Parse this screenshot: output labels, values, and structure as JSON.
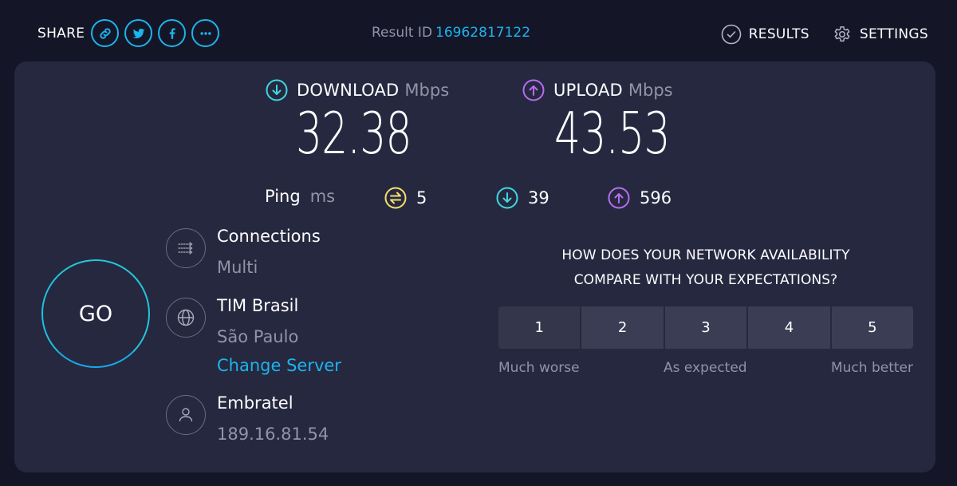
{
  "header": {
    "share_label": "SHARE",
    "share_buttons": [
      {
        "icon": "link-icon",
        "label": "Share link"
      },
      {
        "icon": "twitter-icon",
        "label": "Twitter"
      },
      {
        "icon": "facebook-icon",
        "label": "Facebook"
      },
      {
        "icon": "more-icon",
        "label": "More"
      }
    ],
    "result_id_label": "Result ID",
    "result_id_value": "16962817122",
    "nav": [
      {
        "icon": "checkmark-circle-icon",
        "label": "RESULTS"
      },
      {
        "icon": "gear-icon",
        "label": "SETTINGS"
      }
    ]
  },
  "colors": {
    "accent": "#1cb4ec",
    "download": "#3fd8e0",
    "upload": "#b56ef0",
    "ping": "#f5e06c",
    "background": "#141628",
    "card": "#262840"
  },
  "download": {
    "label": "DOWNLOAD",
    "unit": "Mbps",
    "value": "32.38"
  },
  "upload": {
    "label": "UPLOAD",
    "unit": "Mbps",
    "value": "43.53"
  },
  "ping": {
    "label": "Ping",
    "unit": "ms",
    "idle": "5",
    "download": "39",
    "upload": "596"
  },
  "go_label": "GO",
  "info": {
    "connections": {
      "title": "Connections",
      "value": "Multi"
    },
    "server": {
      "title": "TIM Brasil",
      "location": "São Paulo",
      "change_label": "Change Server"
    },
    "provider": {
      "title": "Embratel",
      "ip": "189.16.81.54"
    }
  },
  "survey": {
    "question_line1": "HOW DOES YOUR NETWORK AVAILABILITY",
    "question_line2": "COMPARE WITH YOUR EXPECTATIONS?",
    "options": [
      "1",
      "2",
      "3",
      "4",
      "5"
    ],
    "label_low": "Much worse",
    "label_mid": "As expected",
    "label_high": "Much better"
  }
}
